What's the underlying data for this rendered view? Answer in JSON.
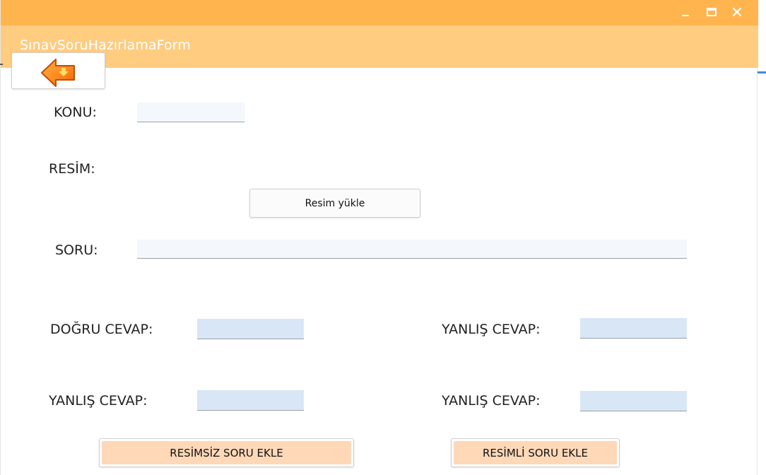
{
  "window": {
    "title": "SınavSoruHazırlamaForm",
    "controls": {
      "minimize_glyph": "_",
      "maximize_glyph": "☐",
      "close_glyph": "✕"
    },
    "title_colors": {
      "top": "#ffb44e",
      "bottom": "#ffcc80"
    }
  },
  "back_button": {
    "icon": "back-arrow-icon"
  },
  "form": {
    "konu_label": "KONU:",
    "konu_value": "",
    "resim_label": "RESİM:",
    "upload_button_label": "Resim yükle",
    "soru_label": "SORU:",
    "soru_value": "",
    "dogru_cevap_label": "DOĞRU CEVAP:",
    "dogru_cevap_value": "",
    "yanlis_cevap_1_label": "YANLIŞ CEVAP:",
    "yanlis_cevap_1_value": "",
    "yanlis_cevap_2_label": "YANLIŞ CEVAP:",
    "yanlis_cevap_2_value": "",
    "yanlis_cevap_3_label": "YANLIŞ CEVAP:",
    "yanlis_cevap_3_value": ""
  },
  "actions": {
    "add_without_image_label": "RESİMSİZ SORU EKLE",
    "add_with_image_label": "RESİMLİ SORU EKLE"
  }
}
